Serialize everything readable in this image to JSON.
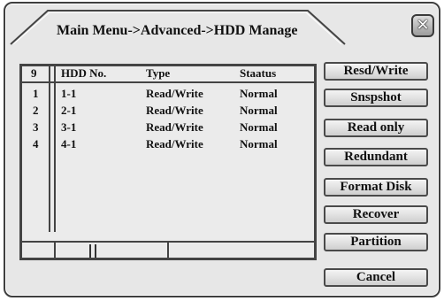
{
  "window": {
    "title": "Main Menu->Advanced->HDD Manage",
    "close_glyph": "✕"
  },
  "table": {
    "headers": {
      "index": "9",
      "hdd_no": "HDD No.",
      "type": "Type",
      "status": "Staatus"
    },
    "rows": [
      {
        "index": "1",
        "hdd_no": "1-1",
        "type": "Read/Write",
        "status": "Normal"
      },
      {
        "index": "2",
        "hdd_no": "2-1",
        "type": "Read/Write",
        "status": "Normal"
      },
      {
        "index": "3",
        "hdd_no": "3-1",
        "type": "Read/Write",
        "status": "Normal"
      },
      {
        "index": "4",
        "hdd_no": "4-1",
        "type": "Read/Write",
        "status": "Normal"
      }
    ]
  },
  "buttons": {
    "read_write": "Resd/Write",
    "snapshot": "Snspshot",
    "read_only": "Read only",
    "redundant": "Redundant",
    "format_disk": "Format Disk",
    "recover": "Recover",
    "partition": "Partition",
    "cancel": "Cancel"
  },
  "icons": {
    "close": "close-icon"
  }
}
